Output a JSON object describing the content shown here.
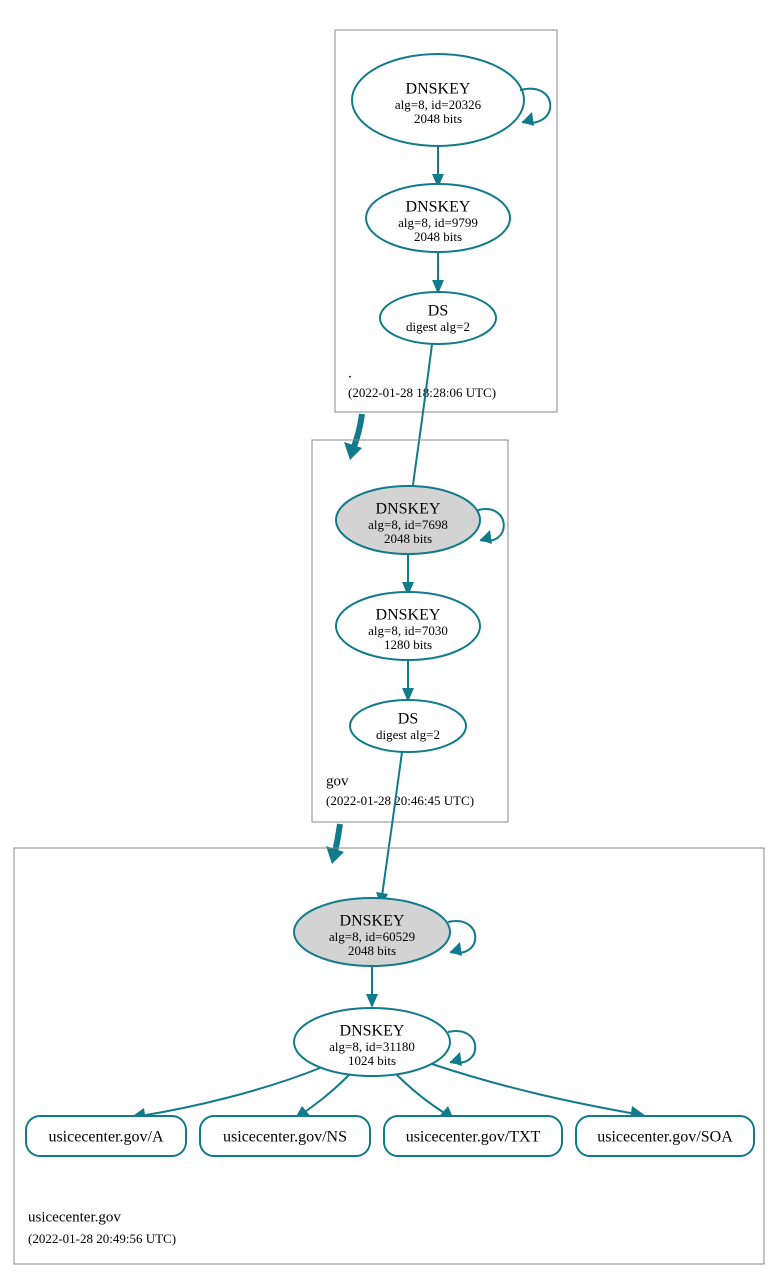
{
  "zones": {
    "root": {
      "label": ".",
      "timestamp": "(2022-01-28 18:28:06 UTC)",
      "ksk": {
        "title": "DNSKEY",
        "line2": "alg=8, id=20326",
        "line3": "2048 bits"
      },
      "zsk": {
        "title": "DNSKEY",
        "line2": "alg=8, id=9799",
        "line3": "2048 bits"
      },
      "ds": {
        "title": "DS",
        "line2": "digest alg=2"
      }
    },
    "gov": {
      "label": "gov",
      "timestamp": "(2022-01-28 20:46:45 UTC)",
      "ksk": {
        "title": "DNSKEY",
        "line2": "alg=8, id=7698",
        "line3": "2048 bits"
      },
      "zsk": {
        "title": "DNSKEY",
        "line2": "alg=8, id=7030",
        "line3": "1280 bits"
      },
      "ds": {
        "title": "DS",
        "line2": "digest alg=2"
      }
    },
    "usicecenter": {
      "label": "usicecenter.gov",
      "timestamp": "(2022-01-28 20:49:56 UTC)",
      "ksk": {
        "title": "DNSKEY",
        "line2": "alg=8, id=60529",
        "line3": "2048 bits"
      },
      "zsk": {
        "title": "DNSKEY",
        "line2": "alg=8, id=31180",
        "line3": "1024 bits"
      },
      "rr": {
        "a": "usicecenter.gov/A",
        "ns": "usicecenter.gov/NS",
        "txt": "usicecenter.gov/TXT",
        "soa": "usicecenter.gov/SOA"
      }
    }
  },
  "colors": {
    "stroke": "#117a8b",
    "fillGray": "#d3d3d3"
  }
}
